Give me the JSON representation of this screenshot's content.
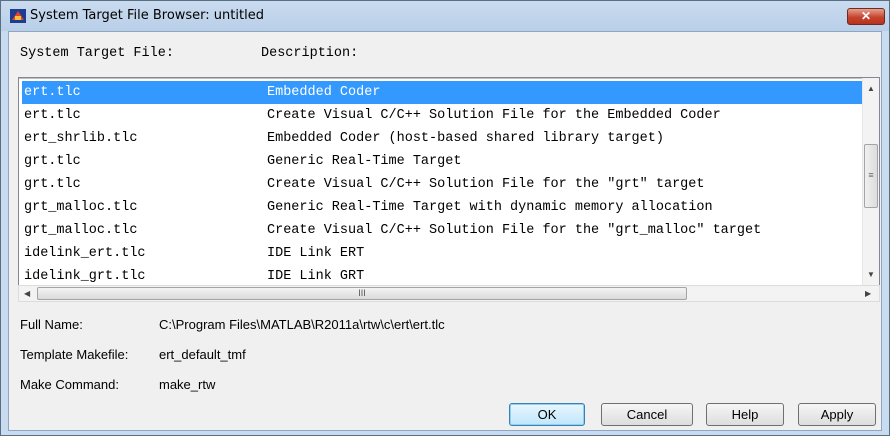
{
  "window": {
    "title": "System Target File Browser: untitled",
    "close_label": "✕"
  },
  "headers": {
    "file": "System Target File:",
    "description": "Description:"
  },
  "rows": [
    {
      "file": "ert.tlc",
      "description": "Embedded Coder",
      "selected": true
    },
    {
      "file": "ert.tlc",
      "description": "Create Visual C/C++ Solution File for the Embedded Coder"
    },
    {
      "file": "ert_shrlib.tlc",
      "description": "Embedded Coder (host-based shared library target)"
    },
    {
      "file": "grt.tlc",
      "description": "Generic Real-Time Target"
    },
    {
      "file": "grt.tlc",
      "description": "Create Visual C/C++ Solution File for the \"grt\" target"
    },
    {
      "file": "grt_malloc.tlc",
      "description": "Generic Real-Time Target with dynamic memory allocation"
    },
    {
      "file": "grt_malloc.tlc",
      "description": "Create Visual C/C++ Solution File for the \"grt_malloc\" target"
    },
    {
      "file": "idelink_ert.tlc",
      "description": "IDE Link ERT"
    },
    {
      "file": "idelink_grt.tlc",
      "description": "IDE Link GRT"
    }
  ],
  "scroll": {
    "up": "▲",
    "down": "▼",
    "left": "◀",
    "right": "▶",
    "grip_v": "≡",
    "grip_h": "III"
  },
  "info": {
    "full_name_label": "Full Name:",
    "full_name_value": "C:\\Program Files\\MATLAB\\R2011a\\rtw\\c\\ert\\ert.tlc",
    "makefile_label": "Template Makefile:",
    "makefile_value": "ert_default_tmf",
    "make_cmd_label": "Make Command:",
    "make_cmd_value": "make_rtw"
  },
  "buttons": {
    "ok": "OK",
    "cancel": "Cancel",
    "help": "Help",
    "apply": "Apply"
  },
  "colors": {
    "selection": "#3399ff",
    "title_bar": "#c9dbef",
    "close_button": "#c5432d"
  }
}
